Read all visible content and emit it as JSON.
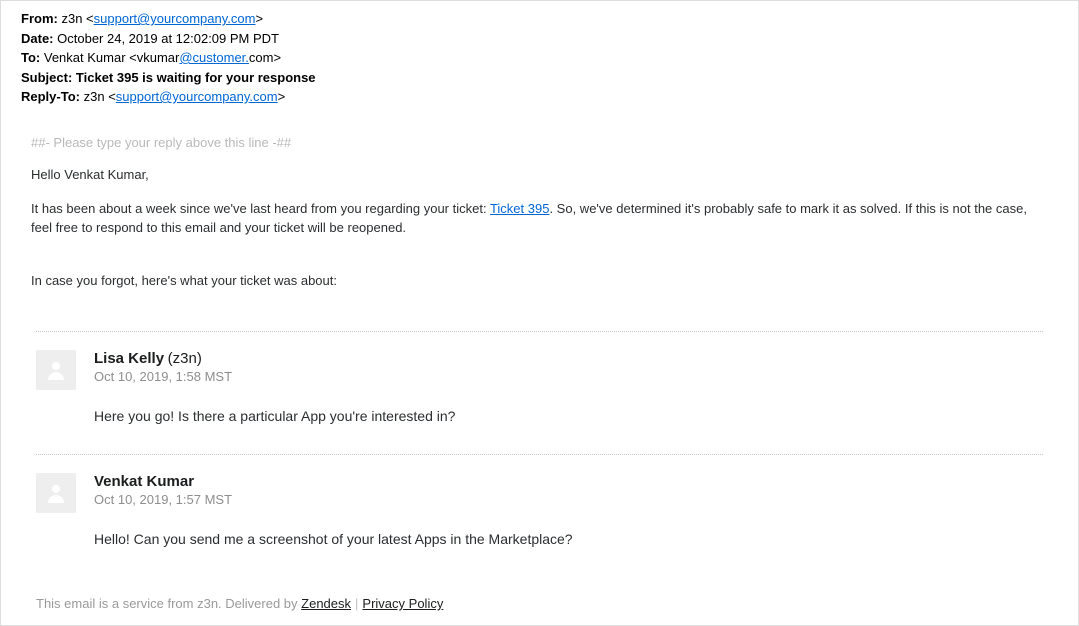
{
  "headers": {
    "from_label": "From:",
    "from_name": "z3n",
    "from_prefix": " <",
    "from_email": "support@yourcompany.com",
    "from_suffix": ">",
    "date_label": "Date:",
    "date_value": "October 24, 2019 at 12:02:09 PM PDT",
    "to_label": "To:",
    "to_text1": "Venkat Kumar <vkumar",
    "to_link": "@customer.",
    "to_text2": "com>",
    "subject_label": "Subject:",
    "subject_value": "Ticket 395 is waiting for your response",
    "reply_to_label": "Reply-To:",
    "reply_to_name": "z3n",
    "reply_to_prefix": " <",
    "reply_to_email": "support@yourcompany.com",
    "reply_to_suffix": ">"
  },
  "reply_hint": "##- Please type your reply above this line -##",
  "body": {
    "greeting": "Hello Venkat Kumar,",
    "p1a": "It has been about a week since we've last heard from you regarding your ticket: ",
    "ticket_link": "Ticket 395",
    "p1b": ". So, we've determined it's probably safe to mark it as solved. If this is not the case, feel free to respond to this email and your ticket will be reopened.",
    "p2": "In case you forgot, here's what your ticket was about:"
  },
  "thread": [
    {
      "name": "Lisa Kelly",
      "org": "(z3n)",
      "time": "Oct 10, 2019, 1:58 MST",
      "text": "Here you go! Is there a particular App you're interested in?"
    },
    {
      "name": "Venkat Kumar",
      "org": "",
      "time": "Oct 10, 2019, 1:57 MST",
      "text": "Hello! Can you send me a screenshot of your latest Apps in the Marketplace?"
    }
  ],
  "footer": {
    "text1": "This email is a service from z3n. Delivered by ",
    "zendesk": "Zendesk",
    "privacy": "Privacy Policy"
  }
}
